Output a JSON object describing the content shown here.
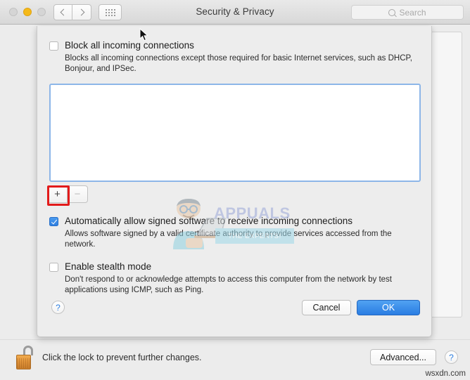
{
  "window": {
    "title": "Security & Privacy",
    "traffic_lights": [
      "close",
      "minimize",
      "zoom"
    ],
    "nav": {
      "back": "‹",
      "forward": "›",
      "show_all": "show-all-grid"
    },
    "search": {
      "placeholder": "Search",
      "value": "",
      "icon": "search-icon"
    }
  },
  "sheet": {
    "block_all": {
      "label": "Block all incoming connections",
      "checked": false,
      "description": "Blocks all incoming connections except those required for basic Internet services,  such as DHCP, Bonjour, and IPSec."
    },
    "app_list": {
      "items": [],
      "focused": true
    },
    "list_controls": {
      "add_label": "+",
      "remove_label": "−",
      "add_enabled": true,
      "remove_enabled": false,
      "highlight_color": "#e21b1b"
    },
    "auto_allow": {
      "label": "Automatically allow signed software to receive incoming connections",
      "checked": true,
      "description": "Allows software signed by a valid certificate authority to provide services accessed from the network."
    },
    "stealth": {
      "label": "Enable stealth mode",
      "checked": false,
      "description": "Don't respond to or acknowledge attempts to access this computer from the network by test applications using ICMP, such as Ping."
    },
    "footer": {
      "help_label": "?",
      "cancel_label": "Cancel",
      "ok_label": "OK",
      "ok_accent": "#2a7de2"
    }
  },
  "bottom_bar": {
    "lock_icon": "open-padlock-icon",
    "lock_text": "Click the lock to prevent further changes.",
    "advanced_label": "Advanced...",
    "help_label": "?"
  },
  "watermarks": {
    "center_brand": "APPUALS",
    "center_tagline": "THE EXPERTS!",
    "corner": "wsxdn.com"
  }
}
